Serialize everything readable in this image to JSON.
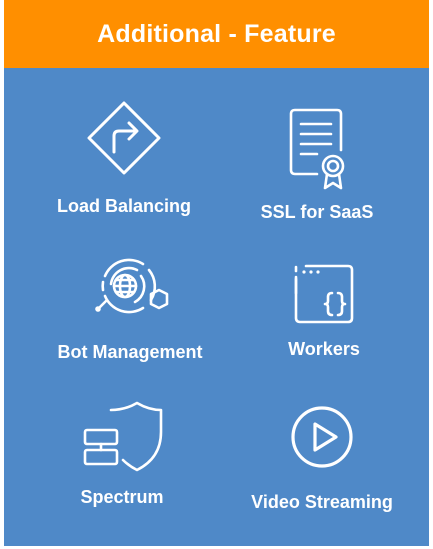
{
  "header": {
    "title": "Additional - Feature"
  },
  "colors": {
    "header_bg": "#ff8f00",
    "panel_bg": "#4f89c8",
    "text": "#ffffff"
  },
  "features": [
    {
      "label": "Load Balancing",
      "icon": "diamond-turn-right-icon"
    },
    {
      "label": "SSL for SaaS",
      "icon": "certificate-icon"
    },
    {
      "label": "Bot Management",
      "icon": "globe-network-icon"
    },
    {
      "label": "Workers",
      "icon": "code-window-icon"
    },
    {
      "label": "Spectrum",
      "icon": "shield-server-icon"
    },
    {
      "label": "Video Streaming",
      "icon": "play-circle-icon"
    }
  ]
}
